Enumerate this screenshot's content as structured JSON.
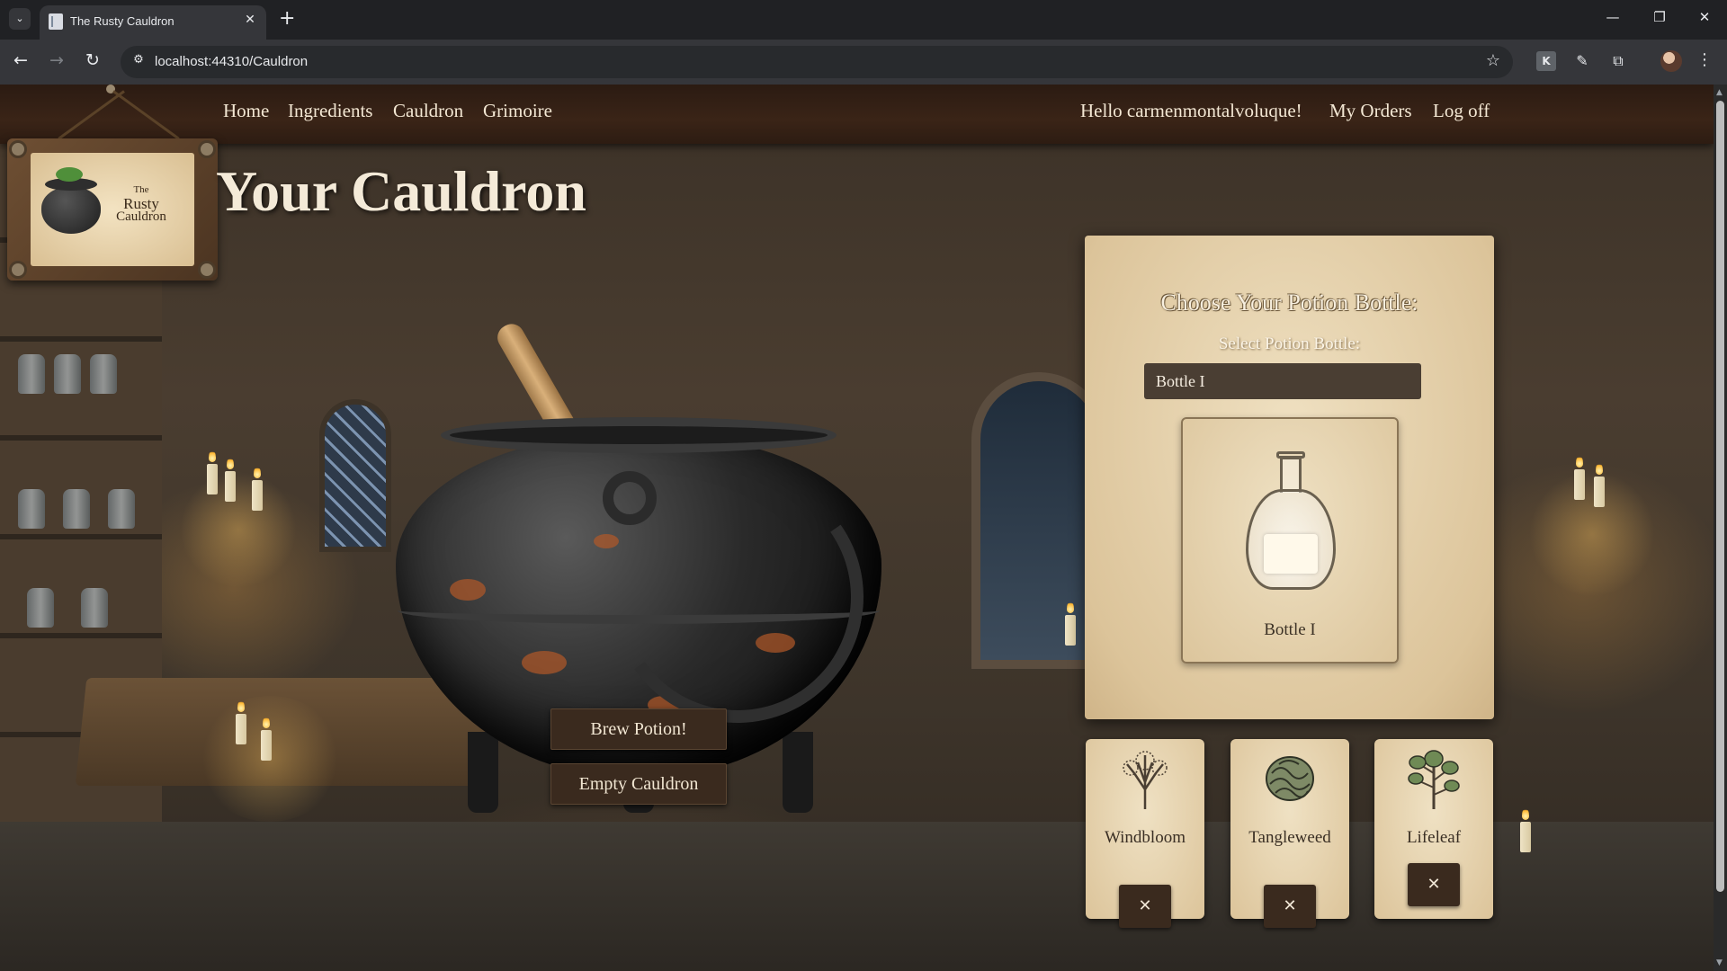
{
  "browser": {
    "tab_title": "The Rusty Cauldron",
    "url": "localhost:44310/Cauldron",
    "new_tab_symbol": "+",
    "close_symbol": "✕"
  },
  "nav": {
    "left_links": [
      "Home",
      "Ingredients",
      "Cauldron",
      "Grimoire"
    ],
    "greeting": "Hello carmenmontalvoluque!",
    "my_orders": "My Orders",
    "log_off": "Log off"
  },
  "logo": {
    "line1": "The",
    "line2": "Rusty",
    "line3": "Cauldron"
  },
  "page": {
    "title": "Your Cauldron"
  },
  "actions": {
    "brew": "Brew Potion!",
    "empty": "Empty Cauldron"
  },
  "bottle_panel": {
    "title": "Choose Your Potion Bottle:",
    "select_label": "Select Potion Bottle:",
    "selected_value": "Bottle I",
    "card_caption": "Bottle I"
  },
  "ingredients": [
    {
      "name": "Windbloom",
      "remove_label": "✕",
      "icon": "windbloom-tree-icon"
    },
    {
      "name": "Tangleweed",
      "remove_label": "✕",
      "icon": "tangleweed-icon"
    },
    {
      "name": "Lifeleaf",
      "remove_label": "✕",
      "icon": "lifeleaf-tree-icon"
    }
  ],
  "colors": {
    "nav_bg": "#3a2417",
    "parchment": "#dcc49a",
    "button_bg": "#3a2a1e",
    "text_light": "#f3e7d3"
  }
}
